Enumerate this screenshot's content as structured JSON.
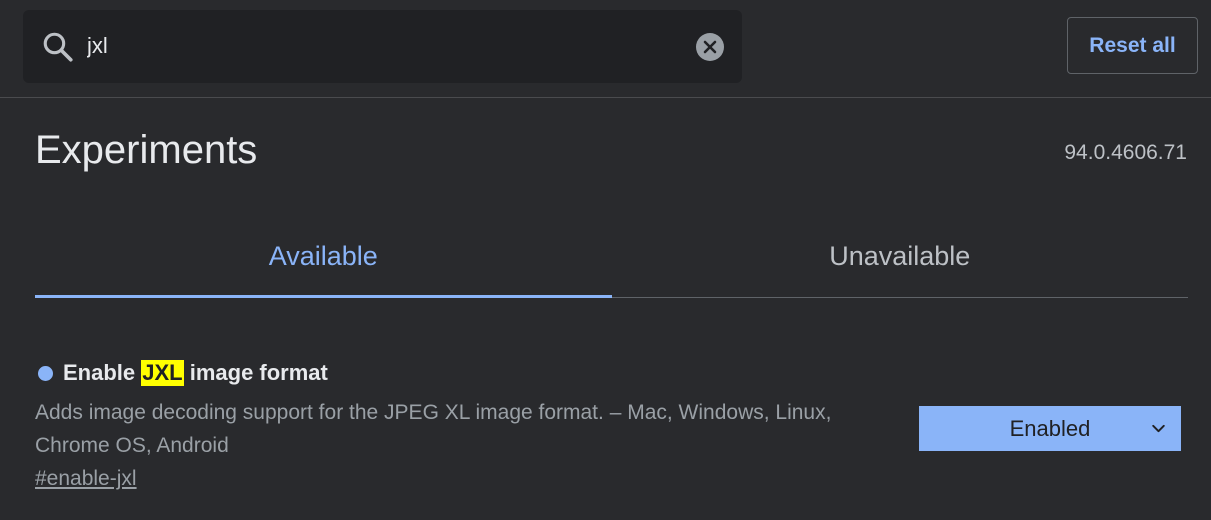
{
  "search": {
    "value": "jxl",
    "icon": "search-icon",
    "clear_icon": "clear-icon"
  },
  "header": {
    "reset_label": "Reset all"
  },
  "page": {
    "title": "Experiments",
    "version": "94.0.4606.71"
  },
  "tabs": [
    {
      "label": "Available",
      "active": true
    },
    {
      "label": "Unavailable",
      "active": false
    }
  ],
  "experiment": {
    "title_before": "Enable ",
    "title_highlight": "JXL",
    "title_after": " image format",
    "description": "Adds image decoding support for the JPEG XL image format. – Mac, Windows, Linux, Chrome OS, Android",
    "link": "#enable-jxl",
    "selected_option": "Enabled",
    "dropdown_icon": "chevron-down-icon"
  },
  "colors": {
    "background": "#292a2d",
    "search_bg": "#202124",
    "accent": "#8ab4f8",
    "highlight": "#ffff00"
  }
}
